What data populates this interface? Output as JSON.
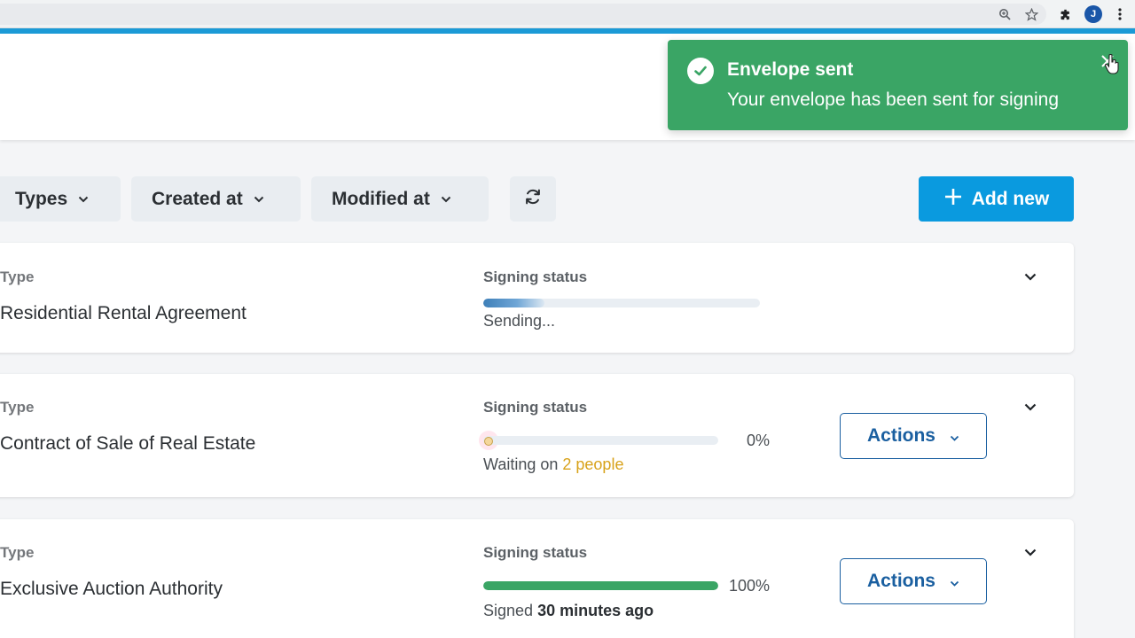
{
  "toast": {
    "title": "Envelope sent",
    "message": "Your envelope has been sent for signing",
    "color": "#3aa565"
  },
  "toolbar": {
    "filters": [
      {
        "label": "Types"
      },
      {
        "label": "Created at"
      },
      {
        "label": "Modified at"
      }
    ],
    "add_label": "Add new",
    "accent": "#0a9adf"
  },
  "envelopes": [
    {
      "type_label": "Type",
      "name": "Residential Rental Agreement",
      "status_label": "Signing status",
      "progress": 0.2,
      "status": "Sending..."
    },
    {
      "type_label": "Type",
      "name": "Contract of Sale of Real Estate",
      "status_label": "Signing status",
      "progress": 0,
      "percent": "0%",
      "status_prefix": "Waiting on",
      "status_highlight": "2 people",
      "actions_label": "Actions"
    },
    {
      "type_label": "Type",
      "name": "Exclusive Auction Authority",
      "status_label": "Signing status",
      "progress": 1,
      "percent": "100%",
      "status_prefix": "Signed",
      "status_strong": "30 minutes ago",
      "actions_label": "Actions"
    }
  ],
  "browser": {
    "avatar_initial": "J",
    "icons": [
      "zoom-icon",
      "star-icon",
      "extensions-icon",
      "avatar",
      "more-icon"
    ]
  }
}
